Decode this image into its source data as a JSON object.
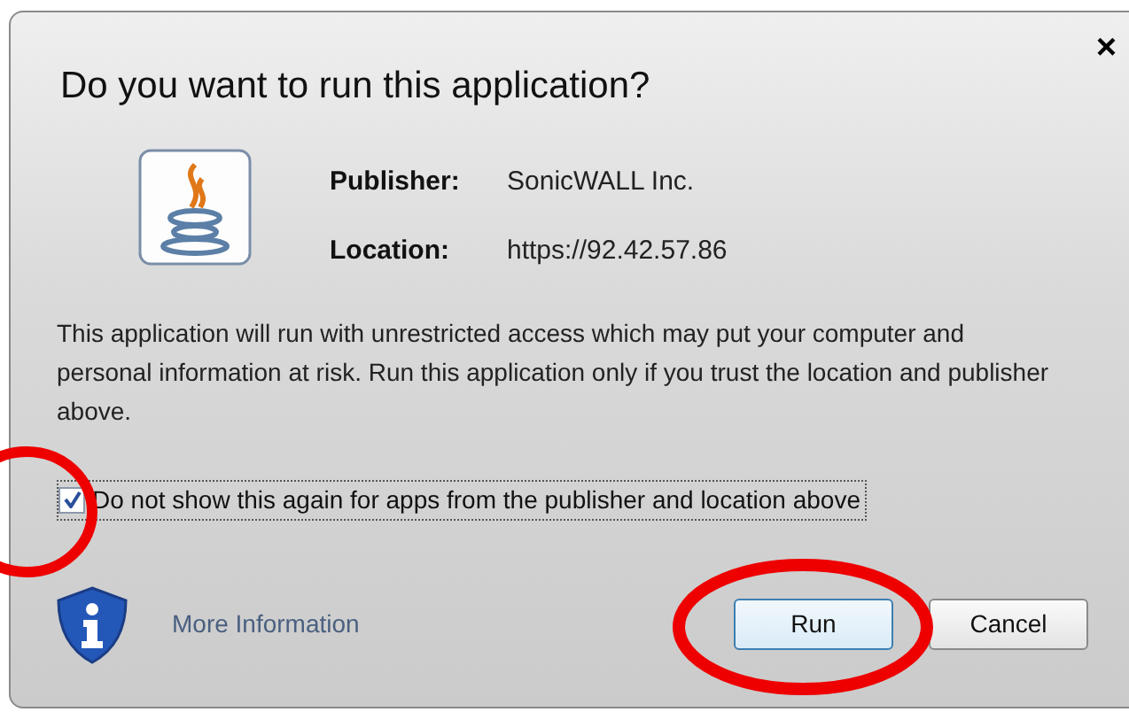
{
  "dialog": {
    "title": "Do you want to run this application?",
    "close": "×",
    "fields": [
      {
        "label": "Publisher:",
        "value": "SonicWALL Inc."
      },
      {
        "label": "Location:",
        "value": "https://92.42.57.86"
      }
    ],
    "warning": "This application will run with unrestricted access which may put your computer and personal information at risk. Run this application only if you trust the location and publisher above.",
    "checkbox": {
      "label": "Do not show this again for apps from the publisher and location above",
      "checked": true
    },
    "more_info": "More Information",
    "buttons": [
      {
        "label": "Run",
        "selected": true
      },
      {
        "label": "Cancel",
        "selected": false
      }
    ]
  }
}
